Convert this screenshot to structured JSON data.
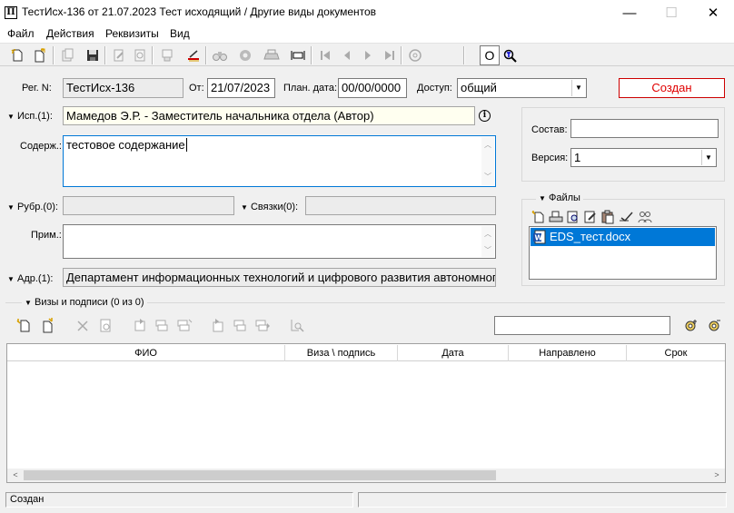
{
  "window": {
    "title": "ТестИсх-136 от 21.07.2023 Тест исходящий / Другие виды документов",
    "app_icon_glyph": "П",
    "min_glyph": "—",
    "max_glyph": "☐",
    "close_glyph": "✕"
  },
  "menu": {
    "items": [
      "Файл",
      "Действия",
      "Реквизиты",
      "Вид"
    ]
  },
  "toolbar": {
    "toggle_o": "O"
  },
  "form": {
    "reg_label": "Рег. N:",
    "reg_value": "ТестИсх-136",
    "from_label": "От:",
    "from_value": "21/07/2023",
    "plan_label": "План. дата:",
    "plan_value": "00/00/0000",
    "access_label": "Доступ:",
    "access_value": "общий",
    "status": "Создан",
    "isp_label": "Исп.(1):",
    "isp_value": "Мамедов Э.Р. - Заместитель начальника отдела (Автор)",
    "content_label": "Содерж.:",
    "content_value": "тестовое содержание",
    "rubr_label": "Рубр.(0):",
    "links_label": "Связки(0):",
    "note_label": "Прим.:",
    "addr_label": "Адр.(1):",
    "addr_value": "Департамент информационных технологий и цифрового развития автономного"
  },
  "side": {
    "composition_label": "Состав:",
    "composition_value": "",
    "version_label": "Версия:",
    "version_value": "1",
    "files_label": "Файлы",
    "files": [
      {
        "name": "EDS_тест.docx",
        "icon": "word-doc-icon"
      }
    ]
  },
  "visas": {
    "section_label": "Визы и подписи (0 из 0)",
    "search_value": "",
    "columns": [
      "ФИО",
      "Виза \\ подпись",
      "Дата",
      "Направлено",
      "Срок"
    ],
    "rows": []
  },
  "statusbar": {
    "left": "Создан",
    "right": ""
  },
  "colors": {
    "status_red": "#e00000",
    "selection_blue": "#0078d7"
  }
}
